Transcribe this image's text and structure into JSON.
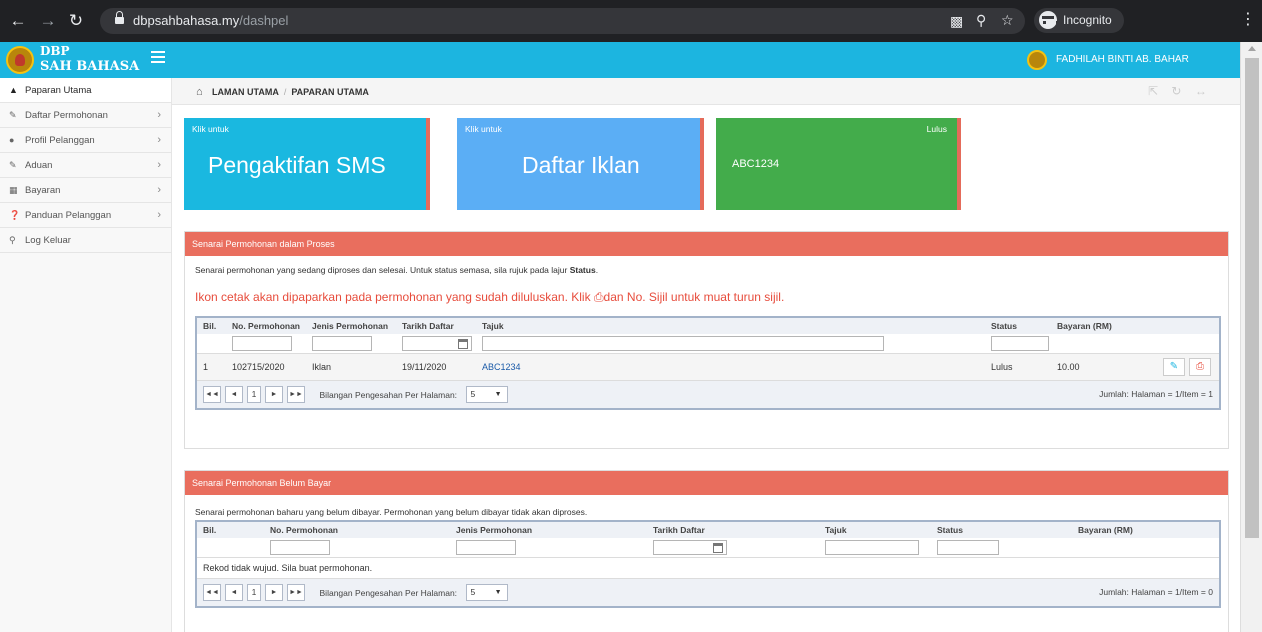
{
  "browser": {
    "url_host": "dbpsahbahasa.my",
    "url_path": "/dashpel",
    "incognito_label": "Incognito"
  },
  "app": {
    "logo_line1": "DBP",
    "logo_line2": "SAH BAHASA",
    "user_name": "FADHILAH BINTI AB. BAHAR",
    "accent_color": "#1cb5e0"
  },
  "sidebar": {
    "items": [
      {
        "label": "Paparan Utama",
        "icon": "home-icon"
      },
      {
        "label": "Daftar Permohonan",
        "icon": "edit-icon"
      },
      {
        "label": "Profil Pelanggan",
        "icon": "user-icon"
      },
      {
        "label": "Aduan",
        "icon": "edit-icon"
      },
      {
        "label": "Bayaran",
        "icon": "table-icon"
      },
      {
        "label": "Panduan Pelanggan",
        "icon": "question-icon"
      },
      {
        "label": "Log Keluar",
        "icon": "key-icon"
      }
    ]
  },
  "breadcrumb": {
    "home": "LAMAN UTAMA",
    "current": "PAPARAN UTAMA"
  },
  "tiles": {
    "sms": {
      "klik": "Klik untuk",
      "title": "Pengaktifan SMS"
    },
    "iklan": {
      "klik": "Klik untuk",
      "title": "Daftar Iklan"
    },
    "lulus": {
      "badge": "Lulus",
      "value": "ABC1234"
    }
  },
  "panel_proses": {
    "heading": "Senarai Permohonan dalam Proses",
    "desc_pre": "Senarai permohonan yang sedang diproses dan selesai. Untuk status semasa, sila rujuk pada lajur ",
    "desc_bold": "Status",
    "desc_post": ".",
    "notice_pre": "Ikon cetak akan dipaparkan pada permohonan yang sudah diluluskan. Klik ",
    "notice_post": "dan No. Sijil untuk muat turun sijil.",
    "columns": {
      "bil": "Bil.",
      "no_permohonan": "No. Permohonan",
      "jenis": "Jenis Permohonan",
      "tarikh": "Tarikh Daftar",
      "tajuk": "Tajuk",
      "status": "Status",
      "bayaran": "Bayaran (RM)"
    },
    "rows": [
      {
        "bil": "1",
        "no_permohonan": "102715/2020",
        "jenis": "Iklan",
        "tarikh": "19/11/2020",
        "tajuk": "ABC1234",
        "status": "Lulus",
        "bayaran": "10.00"
      }
    ],
    "pager": {
      "page": "1",
      "per_page_label": "Bilangan Pengesahan Per Halaman:",
      "per_page": "5",
      "summary": "Jumlah: Halaman = 1/Item = 1"
    }
  },
  "panel_belum_bayar": {
    "heading": "Senarai Permohonan Belum Bayar",
    "desc": "Senarai permohonan baharu yang belum dibayar. Permohonan yang belum dibayar tidak akan diproses.",
    "columns": {
      "bil": "Bil.",
      "no_permohonan": "No. Permohonan",
      "jenis": "Jenis Permohonan",
      "tarikh": "Tarikh Daftar",
      "tajuk": "Tajuk",
      "status": "Status",
      "bayaran": "Bayaran (RM)"
    },
    "empty": "Rekod tidak wujud. Sila buat permohonan.",
    "pager": {
      "page": "1",
      "per_page_label": "Bilangan Pengesahan Per Halaman:",
      "per_page": "5",
      "summary": "Jumlah: Halaman = 1/Item = 0"
    }
  }
}
